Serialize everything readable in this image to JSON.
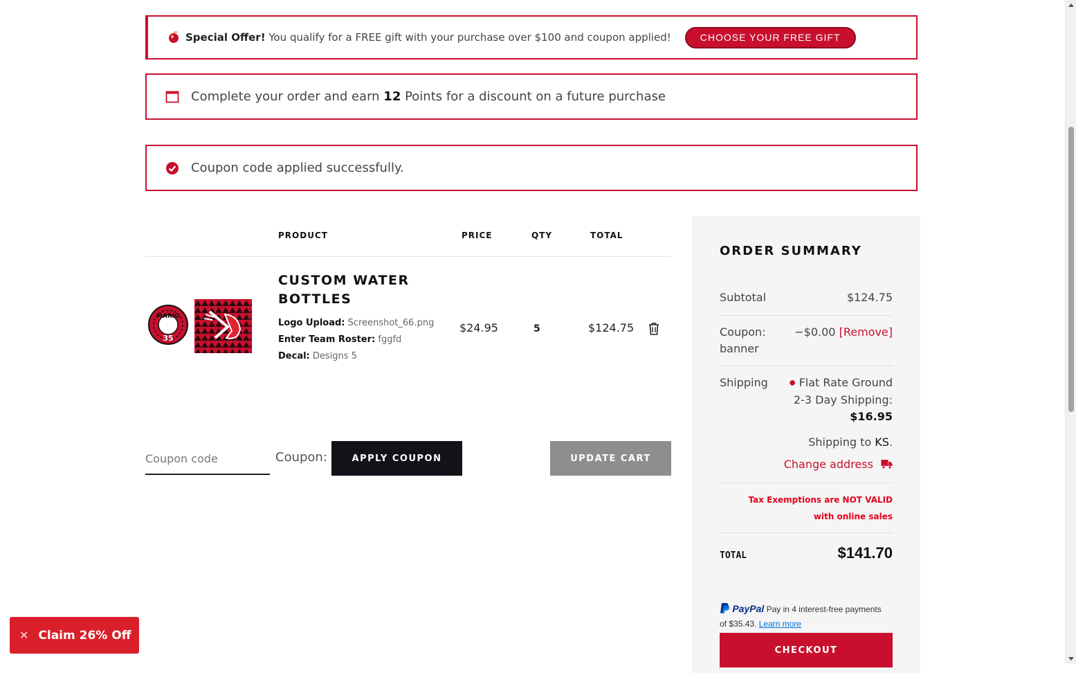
{
  "notices": {
    "offer": {
      "bold": "Special Offer!",
      "text": " You qualify for a FREE gift with your purchase over $100 and coupon applied!",
      "button": "CHOOSE YOUR FREE GIFT"
    },
    "points": {
      "pre": "Complete your order and earn ",
      "bold": "12",
      "post": " Points for a discount on a future purchase"
    },
    "coupon_success": "Coupon code applied successfully."
  },
  "cart": {
    "headers": {
      "product": "PRODUCT",
      "price": "PRICE",
      "qty": "QTY",
      "total": "TOTAL"
    },
    "item": {
      "title": "CUSTOM WATER BOTTLES",
      "meta": [
        {
          "label": "Logo Upload:",
          "value": " Screenshot_66.png"
        },
        {
          "label": "Enter Team Roster:",
          "value": " fggfd"
        },
        {
          "label": "Decal:",
          "value": " Designs 5"
        }
      ],
      "price": "$24.95",
      "qty": "5",
      "total": "$124.75",
      "decal_name": "MARIO",
      "decal_number": "35"
    },
    "coupon_placeholder": "Coupon code",
    "coupon_label": "Coupon:",
    "apply_button": "APPLY COUPON",
    "update_button": "UPDATE CART"
  },
  "summary": {
    "title": "ORDER SUMMARY",
    "subtotal_label": "Subtotal",
    "subtotal_value": "$124.75",
    "coupon_label_1": "Coupon:",
    "coupon_label_2": "banner",
    "coupon_value": "−$0.00",
    "coupon_remove": "[Remove]",
    "shipping_label": "Shipping",
    "shipping_method_1": "Flat Rate Ground",
    "shipping_method_2": "2-3 Day Shipping:",
    "shipping_price": "$16.95",
    "shipping_to_pre": "Shipping to ",
    "shipping_to_state": "KS",
    "shipping_to_post": ".",
    "change_address": "Change address",
    "tax_line_1": "Tax Exemptions are NOT VALID",
    "tax_line_2": "with online sales",
    "total_label": "TOTAL",
    "total_value": "$141.70",
    "paypal_brand": "PayPal",
    "paypal_text_1": " Pay in 4 interest-free payments",
    "paypal_text_2": "of $35.43. ",
    "paypal_learn": "Learn more",
    "checkout_button": "CHECKOUT"
  },
  "promo": {
    "label": "Claim 26% Off",
    "close": "✕"
  },
  "colors": {
    "accent": "#c8102e",
    "dark": "#111318",
    "gray_button": "#8e8e8e",
    "panel": "#f5f5f5"
  }
}
